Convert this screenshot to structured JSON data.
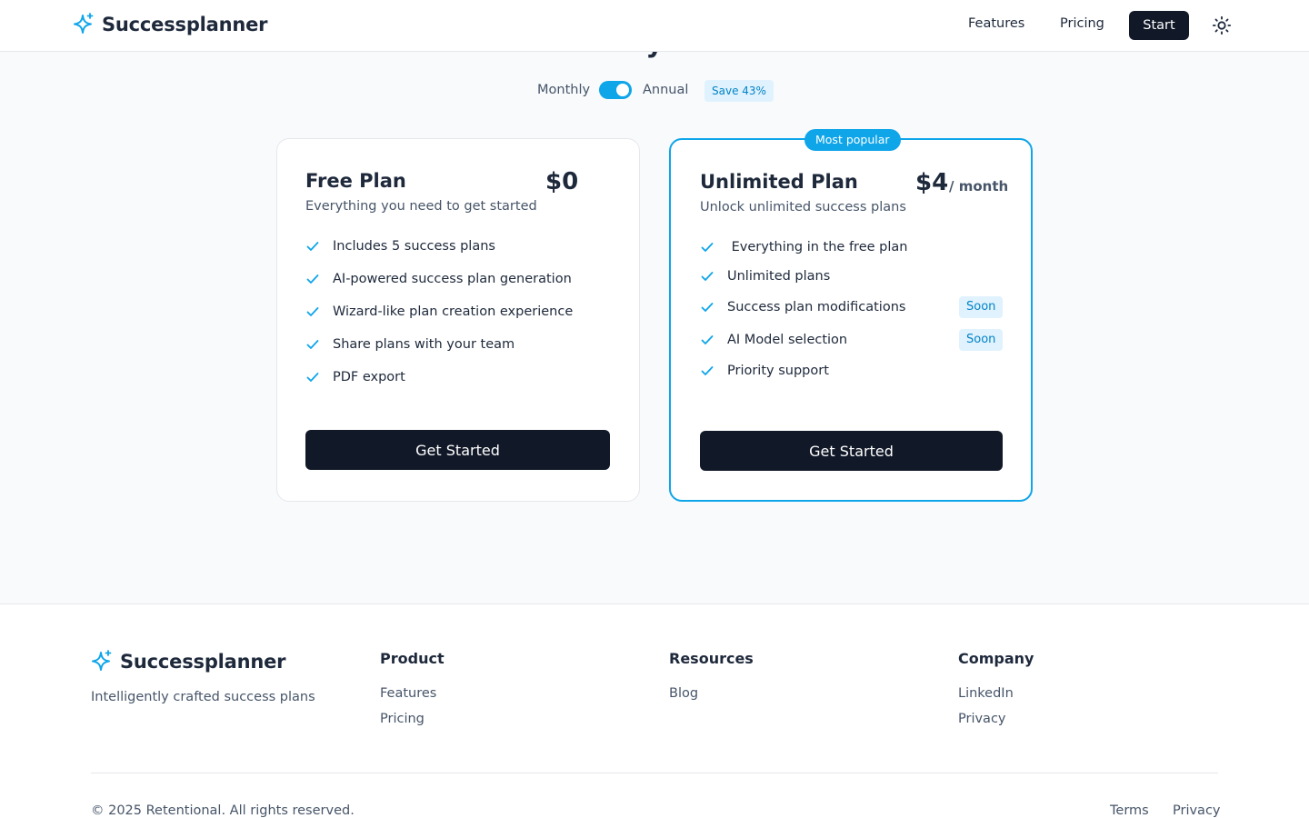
{
  "brand": {
    "name": "Successplanner",
    "accent": "#0ea5e9",
    "dark": "#111827"
  },
  "header": {
    "nav": [
      {
        "label": "Features"
      },
      {
        "label": "Pricing"
      }
    ],
    "start_label": "Start",
    "theme_icon": "sun-icon"
  },
  "hero": {
    "heading_partial": "y"
  },
  "billing": {
    "monthly_label": "Monthly",
    "annual_label": "Annual",
    "annual_selected": true,
    "save_label": "Save 43%"
  },
  "plans": [
    {
      "title": "Free Plan",
      "subtitle": "Everything you need to get started",
      "price": "$0",
      "features": [
        {
          "text": "Includes 5 success plans"
        },
        {
          "text": "AI-powered success plan generation"
        },
        {
          "text": "Wizard-like plan creation experience"
        },
        {
          "text": "Share plans with your team"
        },
        {
          "text": "PDF export"
        }
      ],
      "cta": "Get Started"
    },
    {
      "badge": "Most popular",
      "title": "Unlimited Plan",
      "subtitle": "Unlock unlimited success plans",
      "price": "$4",
      "period": "/ month",
      "features": [
        {
          "text": " Everything in the free plan"
        },
        {
          "text": "Unlimited plans"
        },
        {
          "text": "Success plan modifications",
          "badge": "Soon"
        },
        {
          "text": "AI Model selection",
          "badge": "Soon"
        },
        {
          "text": "Priority support"
        }
      ],
      "cta": "Get Started"
    }
  ],
  "footer": {
    "tagline": "Intelligently crafted success plans",
    "columns": [
      {
        "title": "Product",
        "links": [
          "Features",
          "Pricing"
        ]
      },
      {
        "title": "Resources",
        "links": [
          "Blog"
        ]
      },
      {
        "title": "Company",
        "links": [
          "LinkedIn",
          "Privacy"
        ]
      }
    ],
    "copyright": "© 2025 Retentional. All rights reserved.",
    "legal": [
      "Terms",
      "Privacy"
    ]
  }
}
